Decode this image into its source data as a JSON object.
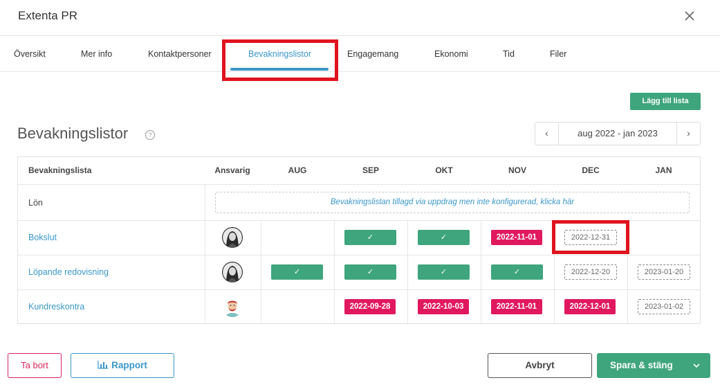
{
  "window": {
    "title": "Extenta PR"
  },
  "tabs": [
    {
      "label": "Översikt"
    },
    {
      "label": "Mer info"
    },
    {
      "label": "Kontaktpersoner"
    },
    {
      "label": "Bevakningslistor"
    },
    {
      "label": "Engagemang"
    },
    {
      "label": "Ekonomi"
    },
    {
      "label": "Tid"
    },
    {
      "label": "Filer"
    }
  ],
  "toolbar": {
    "add_list_label": "Lägg till lista"
  },
  "section": {
    "title": "Bevakningslistor",
    "help_icon": "?"
  },
  "range": {
    "label": "aug 2022 - jan 2023",
    "prev": "‹",
    "next": "›"
  },
  "table": {
    "headers": [
      "Bevakningslista",
      "Ansvarig",
      "AUG",
      "SEP",
      "OKT",
      "NOV",
      "DEC",
      "JAN"
    ],
    "rows": [
      {
        "label": "Lön",
        "notice": "Bevakningslistan tillagd via uppdrag men inte konfigurerad, klicka här"
      },
      {
        "label": "Bokslut",
        "cells": [
          "",
          "✓",
          "✓",
          "2022-11-01",
          "2022-12-31",
          ""
        ]
      },
      {
        "label": "Löpande redovisning",
        "cells": [
          "✓",
          "✓",
          "✓",
          "✓",
          "2022-12-20",
          "2023-01-20"
        ]
      },
      {
        "label": "Kundreskontra",
        "cells": [
          "",
          "2022-09-28",
          "2022-10-03",
          "2022-11-01",
          "2022-12-01",
          "2023-01-02"
        ]
      }
    ]
  },
  "colors": {
    "accent": "#3a97c9",
    "success": "#3fa57d",
    "danger": "#e0195e",
    "highlight": "#e0141f"
  },
  "footer": {
    "delete_label": "Ta bort",
    "report_label": "Rapport",
    "cancel_label": "Avbryt",
    "save_label": "Spara & stäng"
  }
}
